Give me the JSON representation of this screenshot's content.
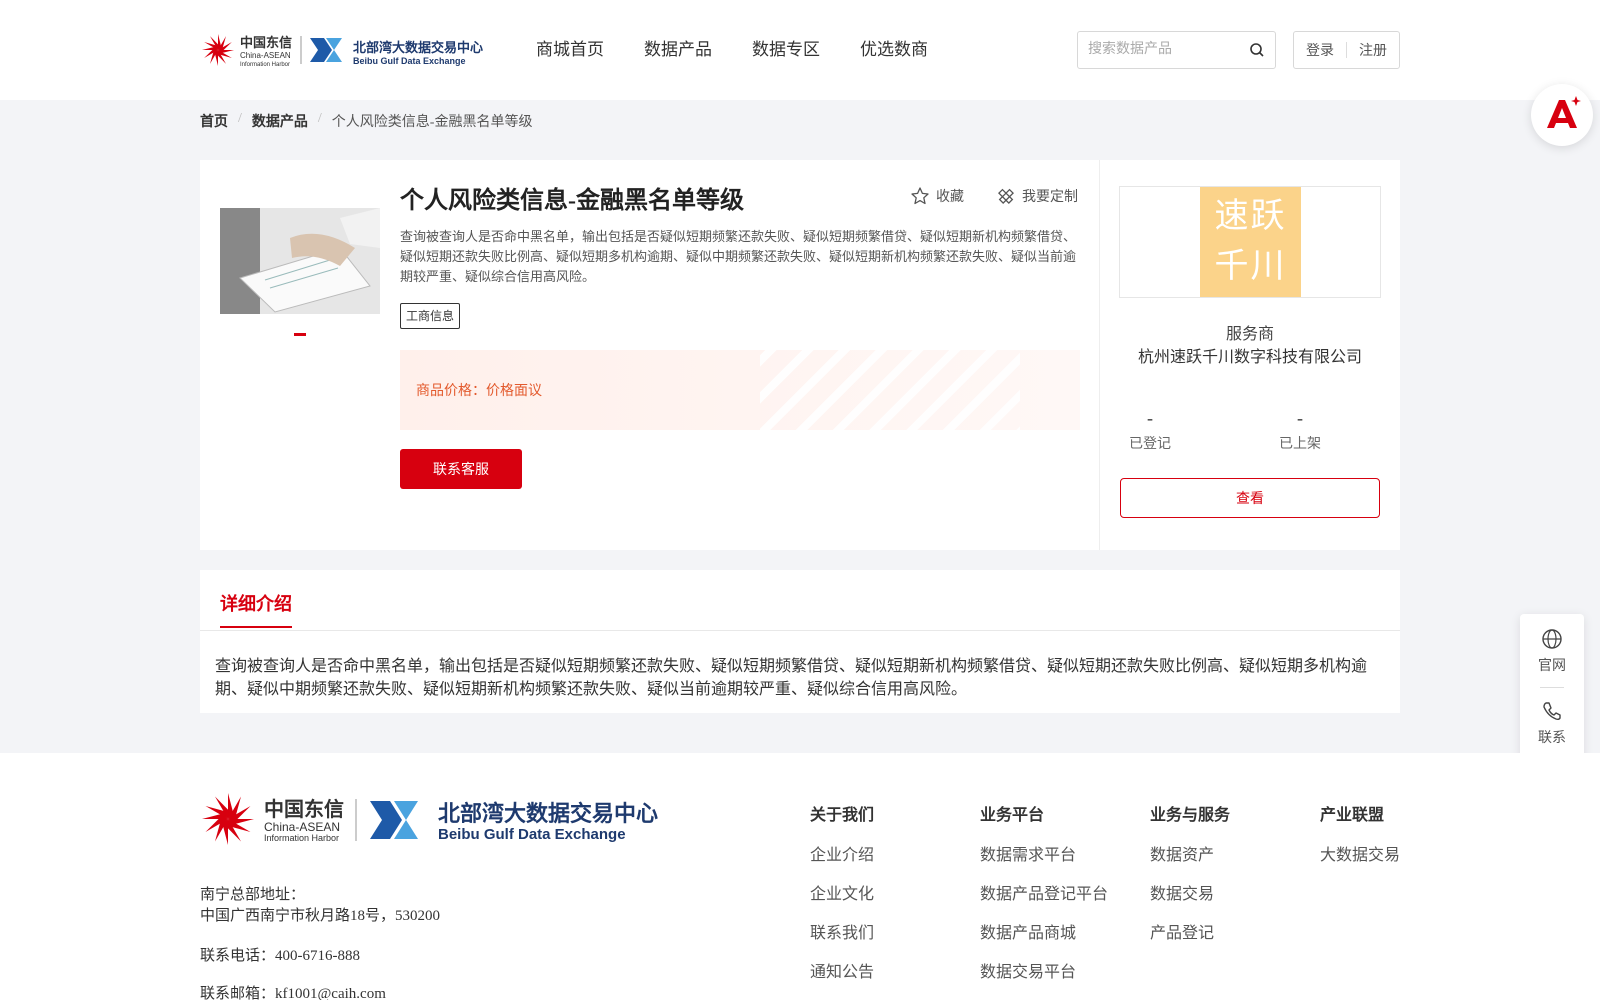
{
  "header": {
    "logo_cn": "中国东信",
    "logo_en": "China-ASEAN",
    "logo_en_sub": "Information Harbor",
    "logo2_cn": "北部湾大数据交易中心",
    "logo2_en": "Beibu Gulf Data Exchange",
    "nav": [
      "商城首页",
      "数据产品",
      "数据专区",
      "优选数商"
    ],
    "search_placeholder": "搜索数据产品",
    "login": "登录",
    "register": "注册"
  },
  "breadcrumb": {
    "home": "首页",
    "category": "数据产品",
    "current": "个人风险类信息-金融黑名单等级"
  },
  "product": {
    "title": "个人风险类信息-金融黑名单等级",
    "favorite": "收藏",
    "customize": "我要定制",
    "description": "查询被查询人是否命中黑名单，输出包括是否疑似短期频繁还款失败、疑似短期频繁借贷、疑似短期新机构频繁借贷、疑似短期还款失败比例高、疑似短期多机构逾期、疑似中期频繁还款失败、疑似短期新机构频繁还款失败、疑似当前逾期较严重、疑似综合信用高风险。",
    "tag": "工商信息",
    "price_label": "商品价格：",
    "price_value": "价格面议",
    "contact_button": "联系客服"
  },
  "vendor": {
    "logo_line1": "速跃",
    "logo_line2": "千川",
    "role": "服务商",
    "name": "杭州速跃千川数字科技有限公司",
    "registered_value": "-",
    "registered_label": "已登记",
    "listed_value": "-",
    "listed_label": "已上架",
    "view_button": "查看"
  },
  "detail": {
    "tab": "详细介绍",
    "text": "查询被查询人是否命中黑名单，输出包括是否疑似短期频繁还款失败、疑似短期频繁借贷、疑似短期新机构频繁借贷、疑似短期还款失败比例高、疑似短期多机构逾期、疑似中期频繁还款失败、疑似短期新机构频繁还款失败、疑似当前逾期较严重、疑似综合信用高风险。"
  },
  "side": {
    "website": "官网",
    "contact": "联系"
  },
  "footer": {
    "address_label": "南宁总部地址：",
    "address": "中国广西南宁市秋月路18号，530200",
    "phone": "联系电话：400-6716-888",
    "email": "联系邮箱：kf1001@caih.com",
    "columns": [
      {
        "heading": "关于我们",
        "items": [
          "企业介绍",
          "企业文化",
          "联系我们",
          "通知公告"
        ]
      },
      {
        "heading": "业务平台",
        "items": [
          "数据需求平台",
          "数据产品登记平台",
          "数据产品商城",
          "数据交易平台"
        ]
      },
      {
        "heading": "业务与服务",
        "items": [
          "数据资产",
          "数据交易",
          "产品登记"
        ]
      },
      {
        "heading": "产业联盟",
        "items": [
          "大数据交易"
        ]
      }
    ]
  },
  "colors": {
    "brand_red": "#d7000f",
    "price_orange": "#e35a2d",
    "logo_blue": "#1e5aa8",
    "vendor_logo_bg": "#fbd38a"
  }
}
